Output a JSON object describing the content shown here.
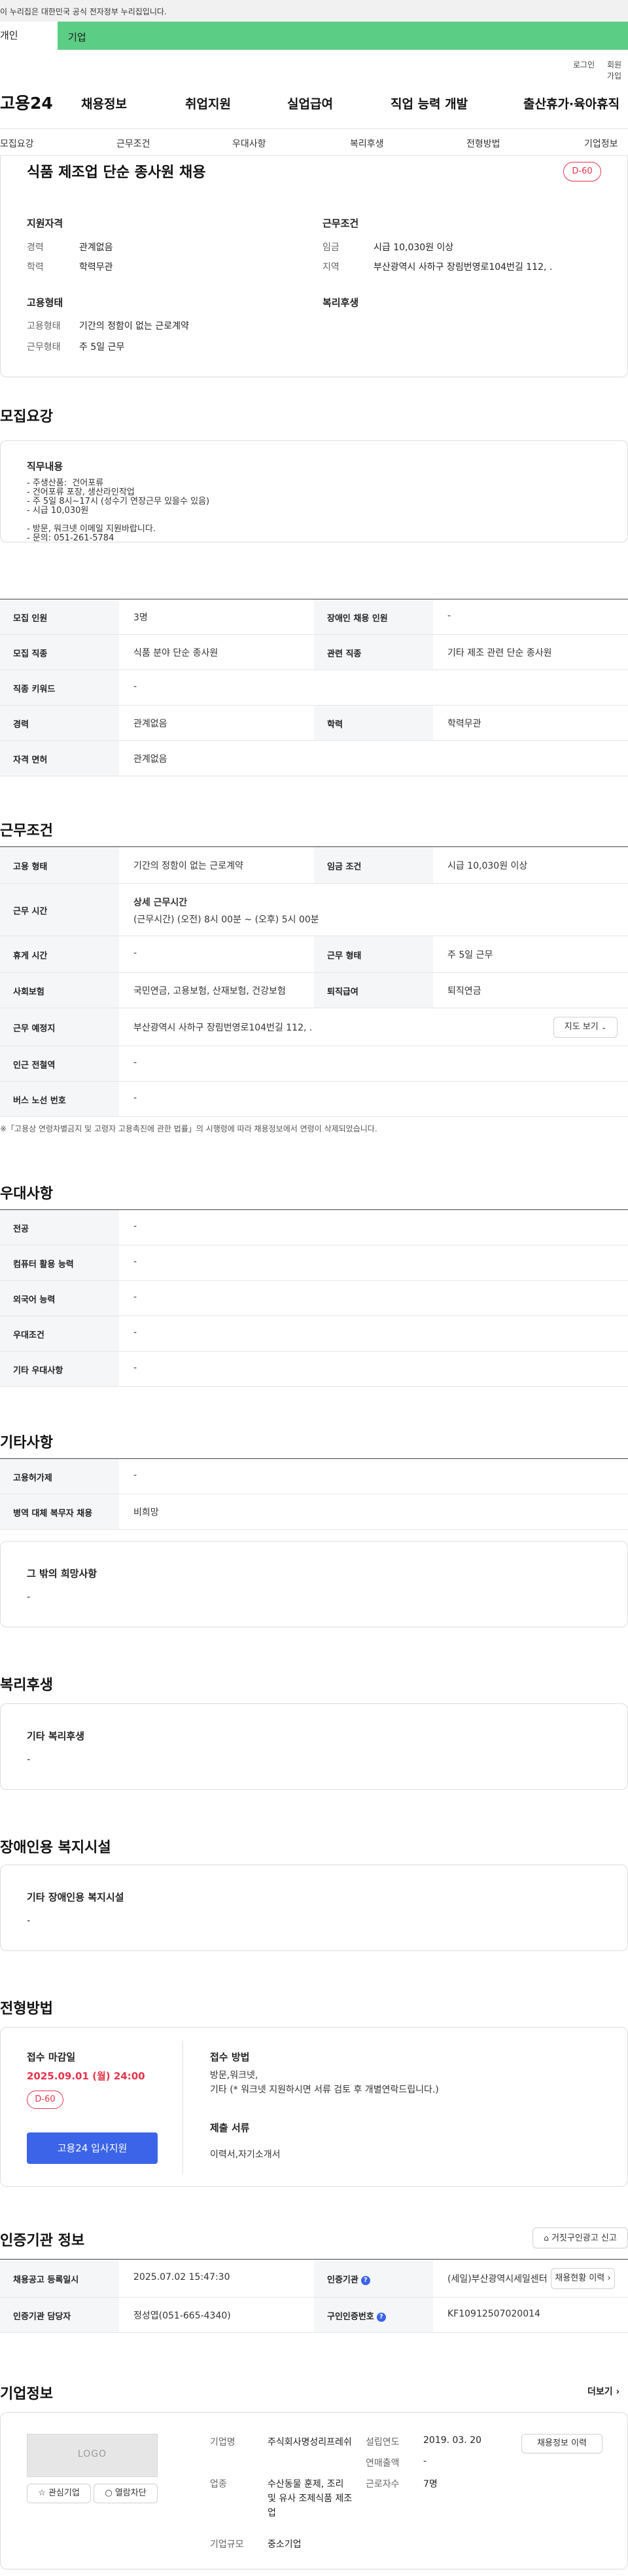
{
  "gov_banner": "이 누리집은 대한민국 공식 전자정부 누리집입니다.",
  "user_tabs": {
    "individual": "개인",
    "corporate": "기업"
  },
  "util": {
    "login": "로그인",
    "signup": "회원가입"
  },
  "site": {
    "logo": "고용24"
  },
  "gnb": [
    "채용정보",
    "취업지원",
    "실업급여",
    "직업 능력 개발",
    "출산휴가·육아휴직"
  ],
  "subnav": [
    "모집요강",
    "근무조건",
    "우대사항",
    "복리후생",
    "전형방법",
    "기업정보"
  ],
  "summary": {
    "title": "식품 제조업 단순 종사원 채용",
    "dday": "D-60",
    "qualification": {
      "heading": "지원자격",
      "career_label": "경력",
      "career_value": "관계없음",
      "education_label": "학력",
      "education_value": "학력무관"
    },
    "conditions": {
      "heading": "근무조건",
      "wage_label": "임금",
      "wage_value": "시급 10,030원 이상",
      "region_label": "지역",
      "region_value": "부산광역시 사하구 장림번영로104번길 112, ."
    },
    "employment": {
      "heading": "고용형태",
      "type_label": "고용형태",
      "type_value": "기간의 정함이 없는 근로계약",
      "shape_label": "근무형태",
      "shape_value": "주 5일 근무"
    },
    "welfare_heading": "복리후생"
  },
  "recruit": {
    "title": "모집요강",
    "duty_heading": "직무내용",
    "duty_text": "- 주생산품:  건어포류\n- 건어포류 포장, 생산라인작업\n- 주 5일 8시~17시 (성수기 연장근무 있을수 있음)\n- 시급 10,030원\n\n- 방문, 워크넷 이메일 지원바랍니다.\n- 문의: 051-261-5784",
    "rows": [
      {
        "k1": "모집 인원",
        "v1": "3명",
        "k2": "장애인 채용 인원",
        "v2": "-"
      },
      {
        "k1": "모집 직종",
        "v1": "식품 분야 단순 종사원",
        "k2": "관련 직종",
        "v2": "기타 제조 관련 단순 종사원"
      },
      {
        "k1": "직종 키워드",
        "v1": "-"
      },
      {
        "k1": "경력",
        "v1": "관계없음",
        "k2": "학력",
        "v2": "학력무관"
      },
      {
        "k1": "자격 면허",
        "v1": "관계없음"
      }
    ]
  },
  "work": {
    "title": "근무조건",
    "type_label": "고용 형태",
    "type_value": "기간의 정함이 없는 근로계약",
    "wage_label": "임금 조건",
    "wage_value": "시급 10,030원 이상",
    "hours_label": "근무 시간",
    "hours_head": "상세 근무시간",
    "hours_value": "(근무시간) (오전) 8시 00분 ~ (오후) 5시 00분",
    "rest_label": "휴게 시간",
    "rest_value": "-",
    "shape_label": "근무 형태",
    "shape_value": "주 5일 근무",
    "insurance_label": "사회보험",
    "insurance_value": "국민연금, 고용보험, 산재보험, 건강보험",
    "retire_label": "퇴직급여",
    "retire_value": "퇴직연금",
    "place_label": "근무 예정지",
    "place_value": "부산광역시 사하구 장림번영로104번길 112, .",
    "map_btn": "지도 보기",
    "subway_label": "인근 전철역",
    "subway_value": "-",
    "bus_label": "버스 노선 번호",
    "bus_value": "-",
    "note": "※「고용상 연령차별금지 및 고령자 고용촉진에 관한 법률」의 시행령에 따라 채용정보에서 연령이 삭제되었습니다."
  },
  "preference": {
    "title": "우대사항",
    "rows": [
      {
        "k": "전공",
        "v": "-"
      },
      {
        "k": "컴퓨터 활용 능력",
        "v": "-"
      },
      {
        "k": "외국어 능력",
        "v": "-"
      },
      {
        "k": "우대조건",
        "v": "-"
      },
      {
        "k": "기타 우대사항",
        "v": "-"
      }
    ]
  },
  "etc": {
    "title": "기타사항",
    "rows": [
      {
        "k": "고용허가제",
        "v": "-"
      },
      {
        "k": "병역 대체 복무자 채용",
        "v": "비희망"
      }
    ],
    "other_heading": "그 밖의 희망사항",
    "other_value": "-"
  },
  "welfare": {
    "title": "복리후생",
    "heading": "기타 복리후생",
    "value": "-"
  },
  "disability": {
    "title": "장애인용 복지시설",
    "heading": "기타 장애인용 복지시설",
    "value": "-"
  },
  "process": {
    "title": "전형방법",
    "deadline_heading": "접수 마감일",
    "deadline_value": "2025.09.01 (월) 24:00",
    "dday": "D-60",
    "apply_btn": "고용24 입사지원",
    "method_heading": "접수 방법",
    "method_value": "방문,워크넷,\n기타 (* 워크넷 지원하시면 서류 검토 후 개별연락드립니다.)",
    "docs_heading": "제출 서류",
    "docs_value": "이력서,자기소개서"
  },
  "cert": {
    "title": "인증기관 정보",
    "report_btn": "거짓구인광고 신고",
    "reg_label": "채용공고 등록일시",
    "reg_value": "2025.07.02 15:47:30",
    "org_label": "인증기관",
    "org_value": "(세일)부산광역시세일센터",
    "history_btn": "채용현황 이력",
    "manager_label": "인증기관 담당자",
    "manager_value": "정성엽(051-665-4340)",
    "cert_no_label": "구인인증번호",
    "cert_no_value": "KF10912507020014"
  },
  "company": {
    "title": "기업정보",
    "more": "더보기",
    "logo_placeholder": "LOGO",
    "fav_btn": "관심기업",
    "block_btn": "열람차단",
    "name_label": "기업명",
    "name_value": "주식회사명성리프레쉬",
    "industry_label": "업종",
    "industry_value": "수산동물 훈제, 조리 및 유사 조제식품 제조업",
    "size_label": "기업규모",
    "size_value": "중소기업",
    "founded_label": "설립연도",
    "founded_value": "2019. 03. 20",
    "revenue_label": "연매출액",
    "revenue_value": "-",
    "employees_label": "근로자수",
    "employees_value": "7명",
    "history_btn": "채용정보 이력"
  }
}
